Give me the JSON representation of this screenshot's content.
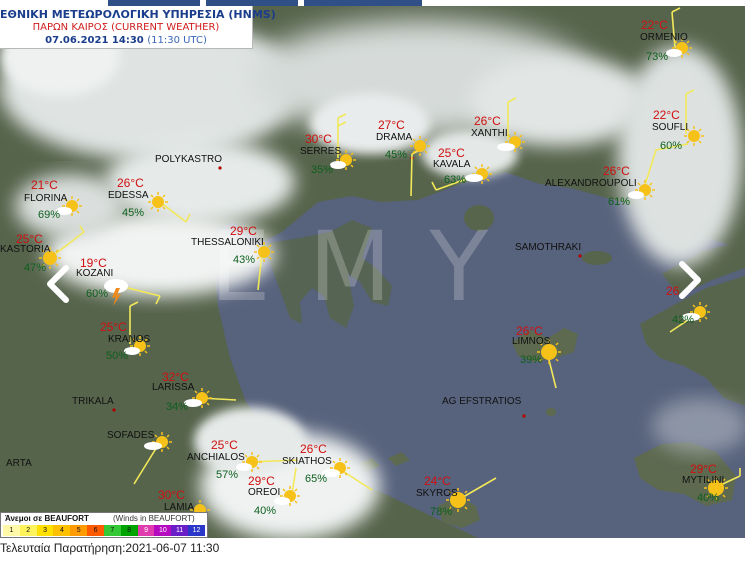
{
  "header": {
    "title": "ΕΘΝΙΚΗ ΜΕΤΕΩΡΟΛΟΓΙΚΗ ΥΠΗΡΕΣΙΑ (HNMS)",
    "subtitle": "ΠΑΡΩΝ ΚΑΙΡΟΣ (CURRENT WEATHER)",
    "datetime": "07.06.2021 14:30",
    "utc": "(11:30 UTC)"
  },
  "watermark": "EMY",
  "stations": [
    {
      "id": "ormenio",
      "name": "ORMENIO",
      "temp": "22°C",
      "humidity": "73%",
      "icon": "sun-cloud-icon"
    },
    {
      "id": "serres",
      "name": "SERRES",
      "temp": "30°C",
      "humidity": "35%",
      "icon": "sun-cloud-icon"
    },
    {
      "id": "drama",
      "name": "DRAMA",
      "temp": "27°C",
      "humidity": "45%",
      "icon": "sun-icon"
    },
    {
      "id": "xanthi",
      "name": "XANTHI",
      "temp": "26°C",
      "humidity": "",
      "icon": "sun-cloud-icon"
    },
    {
      "id": "soufli",
      "name": "SOUFLI",
      "temp": "22°C",
      "humidity": "60%",
      "icon": "sun-icon"
    },
    {
      "id": "kavala",
      "name": "KAVALA",
      "temp": "25°C",
      "humidity": "63%",
      "icon": "sun-cloud-icon"
    },
    {
      "id": "alexandroupoli",
      "name": "ALEXANDROUPOLI",
      "temp": "26°C",
      "humidity": "61%",
      "icon": "sun-cloud-icon"
    },
    {
      "id": "florina",
      "name": "FLORINA",
      "temp": "21°C",
      "humidity": "69%",
      "icon": "sun-cloud-icon"
    },
    {
      "id": "edessa",
      "name": "EDESSA",
      "temp": "26°C",
      "humidity": "45%",
      "icon": "sun-icon"
    },
    {
      "id": "kastoria",
      "name": "KASTORIA",
      "temp": "25°C",
      "humidity": "47%",
      "icon": "sun-icon"
    },
    {
      "id": "thessaloniki",
      "name": "THESSALONIKI",
      "temp": "29°C",
      "humidity": "43%",
      "icon": "sun-icon"
    },
    {
      "id": "kozani",
      "name": "KOZANI",
      "temp": "19°C",
      "humidity": "60%",
      "icon": "thunderstorm-icon"
    },
    {
      "id": "kranos",
      "name": "KRANOS",
      "temp": "25°C",
      "humidity": "50%",
      "icon": "sun-cloud-icon"
    },
    {
      "id": "limnos",
      "name": "LIMNOS",
      "temp": "26°C",
      "humidity": "39%",
      "icon": "sun-icon"
    },
    {
      "id": "larissa",
      "name": "LARISSA",
      "temp": "32°C",
      "humidity": "34%",
      "icon": "sun-cloud-icon"
    },
    {
      "id": "sofades",
      "name": "SOFADES",
      "temp": "",
      "humidity": "",
      "icon": "sun-cloud-icon"
    },
    {
      "id": "anchialos",
      "name": "ANCHIALOS",
      "temp": "25°C",
      "humidity": "57%",
      "icon": "sun-cloud-icon"
    },
    {
      "id": "skiathos",
      "name": "SKIATHOS",
      "temp": "26°C",
      "humidity": "65%",
      "icon": "sun-cloud-icon"
    },
    {
      "id": "oreoi",
      "name": "OREOI",
      "temp": "29°C",
      "humidity": "40%",
      "icon": "sun-cloud-icon"
    },
    {
      "id": "skyros",
      "name": "SKYROS",
      "temp": "24°C",
      "humidity": "78%",
      "icon": "sun-icon"
    },
    {
      "id": "lamia",
      "name": "LAMIA",
      "temp": "30°C",
      "humidity": "",
      "icon": "sun-icon"
    },
    {
      "id": "mytilini",
      "name": "MYTILINI",
      "temp": "29°C",
      "humidity": "40%",
      "icon": "sun-icon"
    },
    {
      "id": "east",
      "name": "",
      "temp": "26",
      "humidity": "42%",
      "icon": "sun-cloud-icon"
    }
  ],
  "places": {
    "polykastro": "POLYKASTRO",
    "samothraki": "SAMOTHRAKI",
    "trikala": "TRIKALA",
    "arta": "ARTA",
    "ag_efstratios": "AG EFSTRATIOS"
  },
  "legend": {
    "title": "Άνεμοι σε BEAUFORT",
    "subtitle": "(Winds in BEAUFORT)",
    "scale": [
      "1",
      "2",
      "3",
      "4",
      "5",
      "6",
      "7",
      "8",
      "9",
      "10",
      "11",
      "12"
    ],
    "colors": [
      "#fff9a8",
      "#fff35c",
      "#ffe000",
      "#ffc000",
      "#ff9a00",
      "#ff5a00",
      "#34c934",
      "#00a400",
      "#e03cb0",
      "#b40ac0",
      "#6a1ec8",
      "#2a37c8"
    ]
  },
  "footer": {
    "last_observation": "Τελευταία Παρατήρηση:2021-06-07 11:30"
  },
  "colors": {
    "land": "#5a6a4f",
    "sea": "#56637e",
    "cloud": "#e8ecec",
    "temp": "#d10f0f",
    "humidity": "#0d5f1d",
    "wind": "#f2e85a"
  }
}
